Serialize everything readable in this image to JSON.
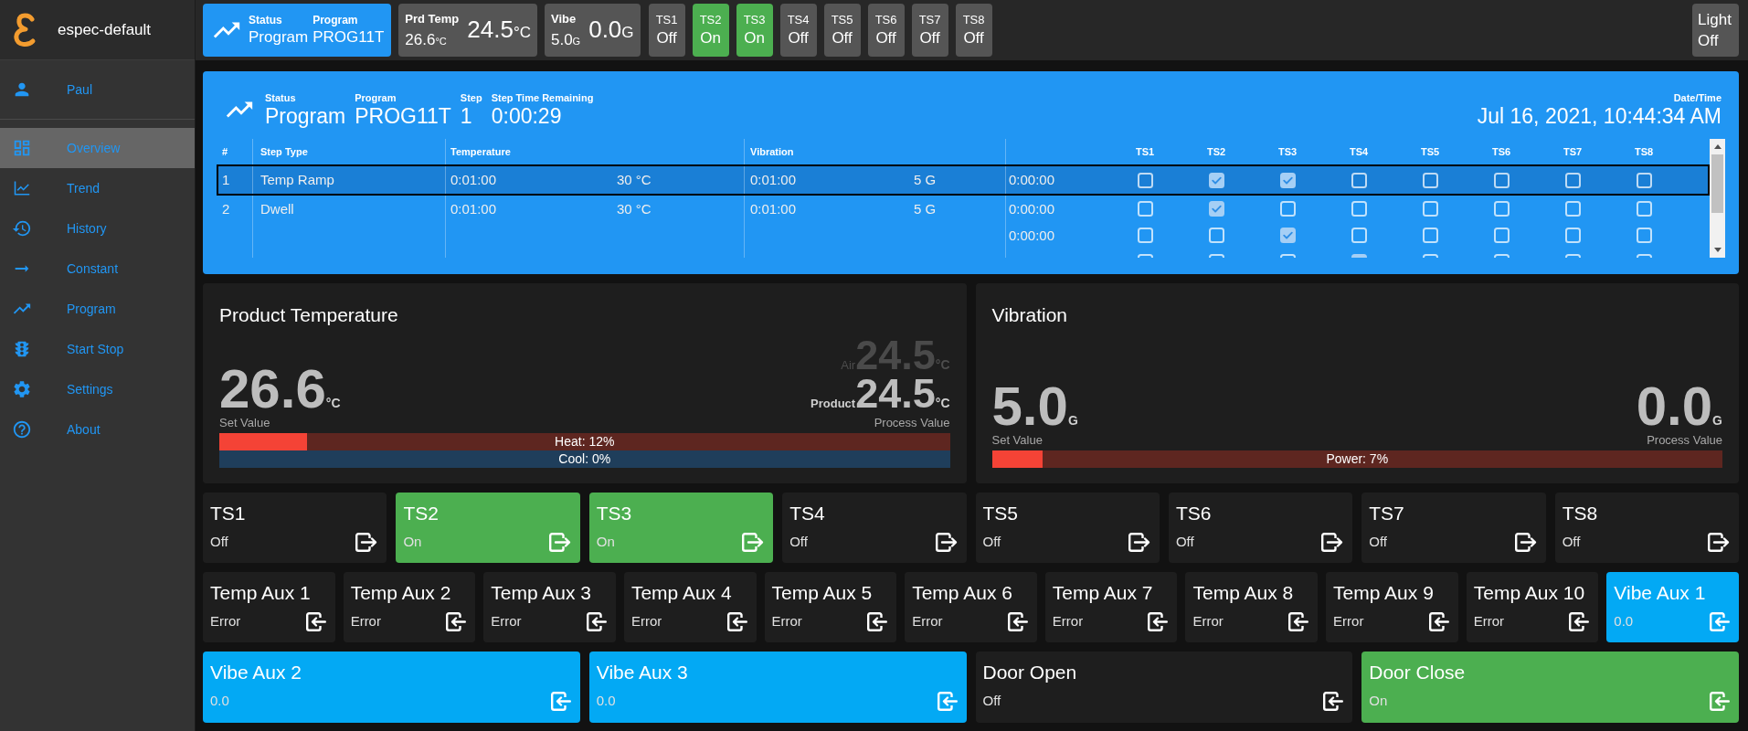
{
  "sidebar": {
    "title": "espec-default",
    "user": "Paul",
    "items": [
      {
        "label": "Overview",
        "selected": true
      },
      {
        "label": "Trend",
        "selected": false
      },
      {
        "label": "History",
        "selected": false
      },
      {
        "label": "Constant",
        "selected": false
      },
      {
        "label": "Program",
        "selected": false
      },
      {
        "label": "Start Stop",
        "selected": false
      },
      {
        "label": "Settings",
        "selected": false
      },
      {
        "label": "About",
        "selected": false
      }
    ]
  },
  "top_bar": {
    "status_tile": {
      "fields": [
        {
          "label": "Status",
          "value": "Program"
        },
        {
          "label": "Program",
          "value": "PROG11T"
        }
      ]
    },
    "product_temp_tile": {
      "label": "Prd Temp",
      "set_value": "26.6",
      "set_unit": "°C",
      "value": "24.5",
      "unit": "°C"
    },
    "vibe_tile": {
      "label": "Vibe",
      "set_value": "5.0",
      "set_unit": "G",
      "value": "0.0",
      "unit": "G"
    },
    "switches": [
      {
        "label": "TS1",
        "value": "Off",
        "on": false
      },
      {
        "label": "TS2",
        "value": "On",
        "on": true
      },
      {
        "label": "TS3",
        "value": "On",
        "on": true
      },
      {
        "label": "TS4",
        "value": "Off",
        "on": false
      },
      {
        "label": "TS5",
        "value": "Off",
        "on": false
      },
      {
        "label": "TS6",
        "value": "Off",
        "on": false
      },
      {
        "label": "TS7",
        "value": "Off",
        "on": false
      },
      {
        "label": "TS8",
        "value": "Off",
        "on": false
      }
    ],
    "light": {
      "label": "Light",
      "value": "Off",
      "on": false
    }
  },
  "program_panel": {
    "fields": [
      {
        "label": "Status",
        "value": "Program"
      },
      {
        "label": "Program",
        "value": "PROG11T"
      },
      {
        "label": "Step",
        "value": "1"
      },
      {
        "label": "Step Time Remaining",
        "value": "0:00:29"
      }
    ],
    "datetime": {
      "label": "Date/Time",
      "value": "Jul 16, 2021, 10:44:34 AM"
    },
    "table": {
      "columns": [
        "#",
        "Step Type",
        "Temperature",
        "Vibration",
        "TS1",
        "TS2",
        "TS3",
        "TS4",
        "TS5",
        "TS6",
        "TS7",
        "TS8"
      ],
      "rows": [
        {
          "number": "1",
          "step_type": "Temp Ramp",
          "temp_time": "0:01:00",
          "temp_value": "30 °C",
          "vibe_time": "0:01:00",
          "vibe_value": "5 G",
          "selected": true,
          "switch_rows": [
            {
              "time": "0:00:00",
              "checks": [
                {
                  "checked": false
                },
                {
                  "checked": true
                },
                {
                  "checked": true
                },
                {
                  "checked": false
                },
                {
                  "checked": false
                },
                {
                  "checked": false
                },
                {
                  "checked": false
                },
                {
                  "checked": false
                }
              ]
            }
          ]
        },
        {
          "number": "2",
          "step_type": "Dwell",
          "temp_time": "0:01:00",
          "temp_value": "30 °C",
          "vibe_time": "0:01:00",
          "vibe_value": "5 G",
          "selected": false,
          "switch_rows": [
            {
              "time": "0:00:00",
              "checks": [
                {
                  "checked": false
                },
                {
                  "checked": true
                },
                {
                  "checked": false
                },
                {
                  "checked": false
                },
                {
                  "checked": false
                },
                {
                  "checked": false
                },
                {
                  "checked": false
                },
                {
                  "checked": false
                }
              ]
            },
            {
              "time": "0:00:00",
              "checks": [
                {
                  "checked": false
                },
                {
                  "checked": false
                },
                {
                  "checked": true
                },
                {
                  "checked": false
                },
                {
                  "checked": false
                },
                {
                  "checked": false
                },
                {
                  "checked": false
                },
                {
                  "checked": false
                }
              ]
            },
            {
              "checks": [
                {
                  "checked": false
                },
                {
                  "checked": false
                },
                {
                  "checked": false
                },
                {
                  "checked": true
                },
                {
                  "checked": false
                },
                {
                  "checked": false
                },
                {
                  "checked": false
                },
                {
                  "checked": false
                }
              ]
            }
          ]
        }
      ]
    }
  },
  "product_temperature": {
    "title": "Product Temperature",
    "set_value": "26.6",
    "set_unit": "°C",
    "set_label": "Set Value",
    "air_label": "Air",
    "air_value": "24.5",
    "air_unit": "°C",
    "product_label": "Product",
    "product_value": "24.5",
    "product_unit": "°C",
    "process_label": "Process Value",
    "bars": [
      {
        "kind": "heat",
        "label": "Heat: 12%",
        "level": 0.12
      },
      {
        "kind": "cool",
        "label": "Cool: 0%"
      }
    ]
  },
  "vibration": {
    "title": "Vibration",
    "set_value": "5.0",
    "set_unit": "G",
    "set_label": "Set Value",
    "process_value": "0.0",
    "process_unit": "G",
    "process_label": "Process Value",
    "bars": [
      {
        "kind": "power",
        "label": "Power: 7%",
        "level": 0.07
      }
    ]
  },
  "output_tiles": [
    {
      "label": "TS1",
      "value": "Off",
      "on": false
    },
    {
      "label": "TS2",
      "value": "On",
      "on": true
    },
    {
      "label": "TS3",
      "value": "On",
      "on": true
    },
    {
      "label": "TS4",
      "value": "Off",
      "on": false
    },
    {
      "label": "TS5",
      "value": "Off",
      "on": false
    },
    {
      "label": "TS6",
      "value": "Off",
      "on": false
    },
    {
      "label": "TS7",
      "value": "Off",
      "on": false
    },
    {
      "label": "TS8",
      "value": "Off",
      "on": false
    }
  ],
  "input_tiles": [
    {
      "kind": "temp",
      "label": "Temp Aux 1",
      "value": "Error"
    },
    {
      "kind": "temp",
      "label": "Temp Aux 2",
      "value": "Error"
    },
    {
      "kind": "temp",
      "label": "Temp Aux 3",
      "value": "Error"
    },
    {
      "kind": "temp",
      "label": "Temp Aux 4",
      "value": "Error"
    },
    {
      "kind": "temp",
      "label": "Temp Aux 5",
      "value": "Error"
    },
    {
      "kind": "temp",
      "label": "Temp Aux 6",
      "value": "Error"
    },
    {
      "kind": "temp",
      "label": "Temp Aux 7",
      "value": "Error"
    },
    {
      "kind": "temp",
      "label": "Temp Aux 8",
      "value": "Error"
    },
    {
      "kind": "temp",
      "label": "Temp Aux 9",
      "value": "Error"
    },
    {
      "kind": "temp",
      "label": "Temp Aux 10",
      "value": "Error"
    },
    {
      "kind": "vibe",
      "label": "Vibe Aux 1",
      "value": "0.0"
    }
  ],
  "bottom_tiles": [
    {
      "kind": "vibe",
      "label": "Vibe Aux 2",
      "value": "0.0"
    },
    {
      "kind": "vibe",
      "label": "Vibe Aux 3",
      "value": "0.0"
    },
    {
      "kind": "door",
      "label": "Door Open",
      "value": "Off",
      "on": false
    },
    {
      "kind": "door",
      "label": "Door Close",
      "value": "On",
      "on": true
    }
  ]
}
